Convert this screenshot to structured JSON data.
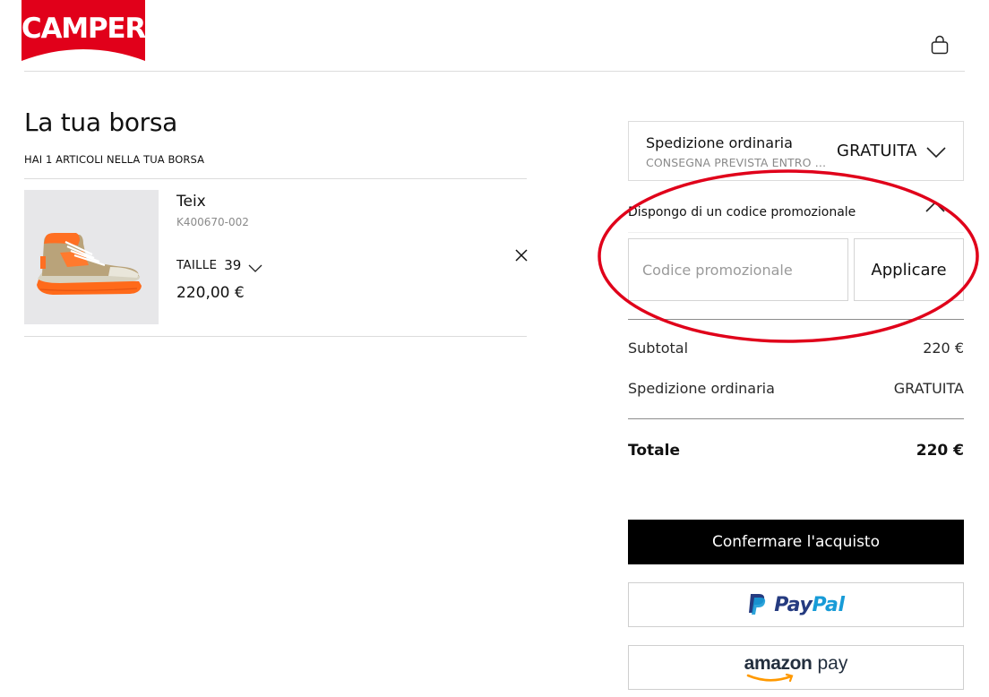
{
  "header": {
    "logo_text": "CAMPER",
    "bag_icon": "shopping-bag-icon"
  },
  "bag": {
    "title": "La tua borsa",
    "items_count_text": "HAI 1 ARTICOLI NELLA TUA BORSA",
    "items": [
      {
        "name": "Teix",
        "sku": "K400670-002",
        "size_label": "TAILLE",
        "size_value": "39",
        "price": "220,00 €"
      }
    ]
  },
  "shipping": {
    "title": "Spedizione ordinaria",
    "subtitle": "CONSEGNA PREVISTA ENTRO 3...",
    "price": "GRATUITA"
  },
  "promo": {
    "label": "Dispongo di un codice promozionale",
    "placeholder": "Codice promozionale",
    "apply_label": "Applicare"
  },
  "summary": {
    "subtotal_label": "Subtotal",
    "subtotal_value": "220 €",
    "shipping_label": "Spedizione ordinaria",
    "shipping_value": "GRATUITA",
    "total_label": "Totale",
    "total_value": "220 €"
  },
  "actions": {
    "confirm_label": "Confermare l'acquisto",
    "paypal_part1": "Pay",
    "paypal_part2": "Pal",
    "amazon_word": "amazon",
    "amazon_pay_word": "pay"
  },
  "colors": {
    "annotation": "#e0001a",
    "logo_red": "#e1001a",
    "paypal_dark": "#253b80",
    "paypal_light": "#179bd7",
    "amazon_orange": "#ff9900"
  }
}
